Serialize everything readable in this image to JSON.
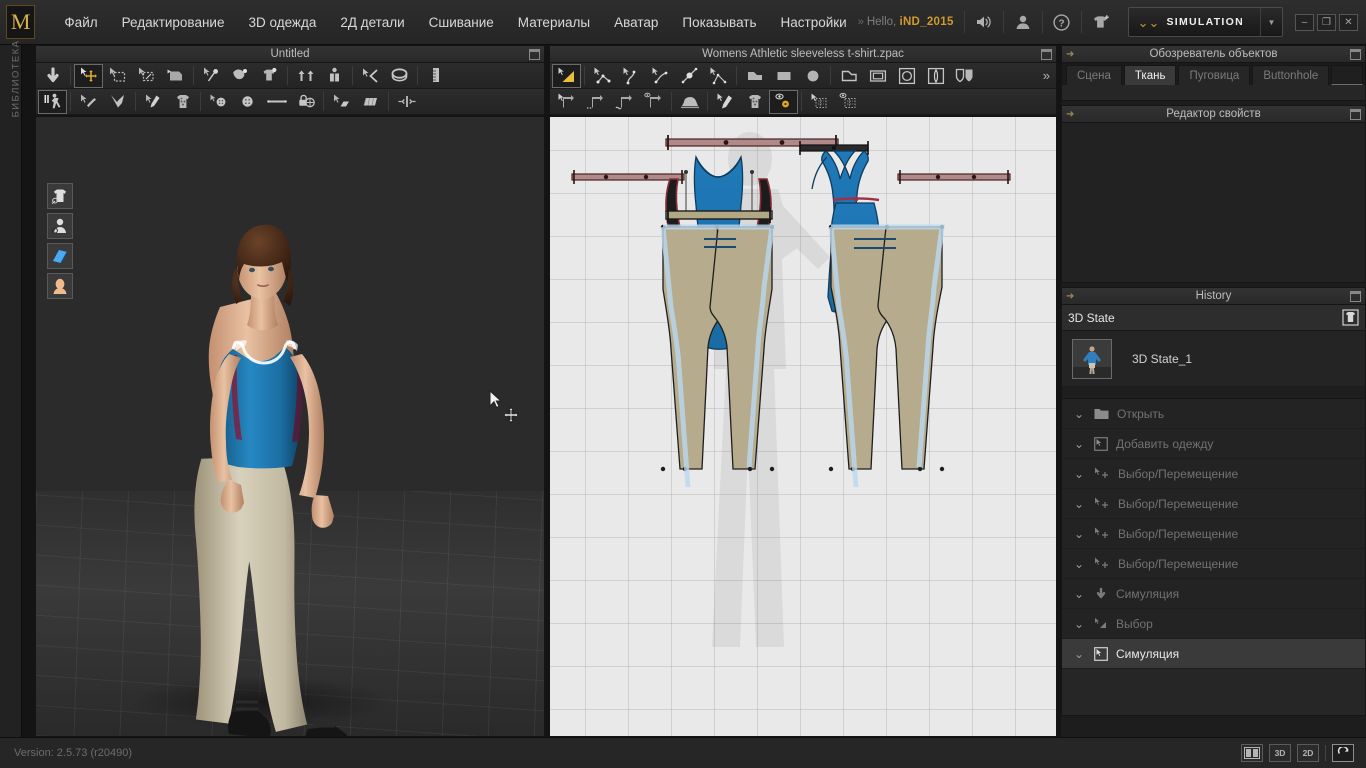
{
  "app": {
    "logo_letter": "M",
    "version": "Version: 2.5.73    (r20490)"
  },
  "menubar": {
    "items": [
      {
        "label": "Файл",
        "name": "menu-file"
      },
      {
        "label": "Редактирование",
        "name": "menu-edit"
      },
      {
        "label": "3D одежда",
        "name": "menu-3d-garment"
      },
      {
        "label": "2Д детали",
        "name": "menu-2d-pattern"
      },
      {
        "label": "Сшивание",
        "name": "menu-sewing"
      },
      {
        "label": "Материалы",
        "name": "menu-materials"
      },
      {
        "label": "Аватар",
        "name": "menu-avatar"
      },
      {
        "label": "Показывать",
        "name": "menu-display"
      },
      {
        "label": "Настройки",
        "name": "menu-settings"
      }
    ],
    "greeting_prefix": "Hello, ",
    "user": "iND_2015",
    "simulation_label": "SIMULATION",
    "window_buttons": [
      "–",
      "❐",
      "✕"
    ]
  },
  "library": {
    "label": "БИБЛИОТЕКА"
  },
  "panel3d": {
    "title": "Untitled",
    "viewport_icons": [
      "garment-visibility-icon",
      "avatar-visibility-icon",
      "fabric-book-icon",
      "skin-face-icon"
    ]
  },
  "panel2d": {
    "title": "Womens Athletic sleeveless t-shirt.zpac",
    "overflow_label": "»"
  },
  "object_browser": {
    "title": "Обозреватель объектов",
    "tabs": [
      {
        "label": "Сцена",
        "active": false
      },
      {
        "label": "Ткань",
        "active": true
      },
      {
        "label": "Пуговица",
        "active": false
      },
      {
        "label": "Buttonhole",
        "active": false
      }
    ]
  },
  "property_editor": {
    "title": "Редактор свойств"
  },
  "history": {
    "title": "History",
    "state_group": "3D State",
    "state_item": "3D State_1",
    "items": [
      {
        "label": "Открыть",
        "icon": "folder-icon",
        "selected": false
      },
      {
        "label": "Добавить одежду",
        "icon": "add-garment-icon",
        "selected": false
      },
      {
        "label": "Выбор/Перемещение",
        "icon": "select-move-icon",
        "selected": false
      },
      {
        "label": "Выбор/Перемещение",
        "icon": "select-move-icon",
        "selected": false
      },
      {
        "label": "Выбор/Перемещение",
        "icon": "select-move-icon",
        "selected": false
      },
      {
        "label": "Выбор/Перемещение",
        "icon": "select-move-icon",
        "selected": false
      },
      {
        "label": "Симуляция",
        "icon": "simulate-icon",
        "selected": false
      },
      {
        "label": "Выбор",
        "icon": "select-icon",
        "selected": false
      },
      {
        "label": "Симуляция",
        "icon": "simulate-cursor-icon",
        "selected": true
      }
    ]
  },
  "statusbar": {
    "buttons": [
      {
        "label": "",
        "name": "split-view-button",
        "active": false
      },
      {
        "label": "3D",
        "name": "view-3d-button",
        "active": false
      },
      {
        "label": "2D",
        "name": "view-2d-button",
        "active": false
      },
      {
        "label": "↻",
        "name": "sync-button",
        "active": true
      }
    ]
  },
  "colors": {
    "accent": "#d09a2c",
    "garment_blue": "#1f74ab",
    "pants_khaki": "#b6ab8d",
    "selection_blue": "#bcd9f0"
  }
}
